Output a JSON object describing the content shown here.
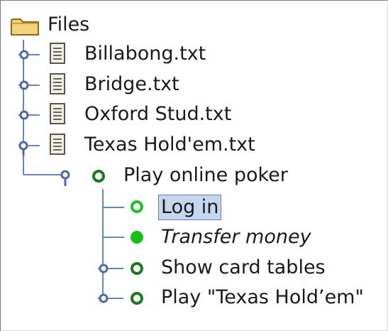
{
  "tree": {
    "root": {
      "label": "Files",
      "icon": "folder-icon"
    },
    "files": [
      {
        "label": "Billabong.txt",
        "icon": "text-file-icon",
        "expanded": false
      },
      {
        "label": "Bridge.txt",
        "icon": "text-file-icon",
        "expanded": false
      },
      {
        "label": "Oxford Stud.txt",
        "icon": "text-file-icon",
        "expanded": false
      },
      {
        "label": "Texas Hold'em.txt",
        "icon": "text-file-icon",
        "expanded": true
      }
    ],
    "goal": {
      "label": "Play online poker",
      "icon": "goal-circle-icon",
      "expanded": true
    },
    "children": [
      {
        "label": "Log in",
        "icon": "outline-circle-icon",
        "selected": true
      },
      {
        "label": "Transfer money",
        "icon": "filled-circle-icon",
        "italic": true
      },
      {
        "label": "Show card tables",
        "icon": "goal-circle-icon",
        "expanded": false
      },
      {
        "label": "Play \"Texas Hold’em\"",
        "icon": "goal-circle-icon",
        "expanded": false
      }
    ]
  },
  "colors": {
    "connector": "#6a86b8",
    "handle": "#4a6aa8",
    "green_dark": "#1f7a1f",
    "green_bright": "#22c022",
    "selection_bg": "#c6d6ee",
    "selection_border": "#5b7fb5"
  }
}
